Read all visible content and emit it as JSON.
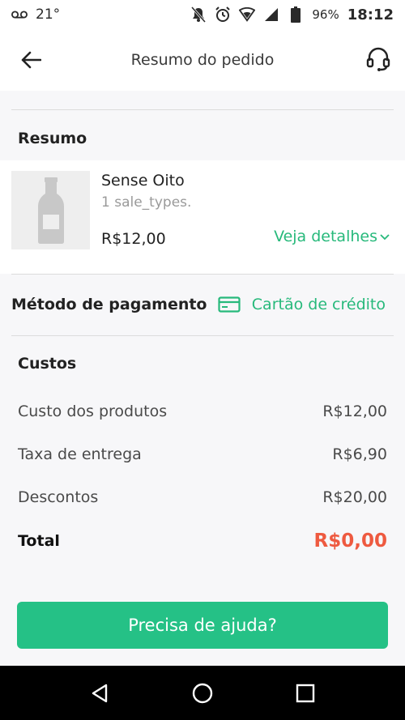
{
  "status_bar": {
    "temperature": "21°",
    "battery": "96%",
    "time": "18:12",
    "icons": [
      "voicemail-icon",
      "bell-off-icon",
      "alarm-icon",
      "wifi-icon",
      "signal-icon",
      "battery-icon"
    ]
  },
  "header": {
    "title": "Resumo do pedido",
    "back_icon": "arrow-left-icon",
    "support_icon": "headset-icon"
  },
  "summary": {
    "title": "Resumo",
    "product": {
      "name": "Sense Oito",
      "quantity": "1 sale_types.",
      "price": "R$12,00",
      "details_link": "Veja detalhes",
      "image_icon": "bottle-icon"
    }
  },
  "payment": {
    "label": "Método de pagamento",
    "method": "Cartão de crédito",
    "icon": "credit-card-icon"
  },
  "costs": {
    "title": "Custos",
    "rows": [
      {
        "label": "Custo dos produtos",
        "value": "R$12,00"
      },
      {
        "label": "Taxa de entrega",
        "value": "R$6,90"
      },
      {
        "label": "Descontos",
        "value": "R$20,00"
      }
    ],
    "total_label": "Total",
    "total_value": "R$0,00"
  },
  "help_button": "Precisa de ajuda?",
  "colors": {
    "accent": "#27b97b",
    "button": "#25c186",
    "total": "#ee5a40"
  }
}
